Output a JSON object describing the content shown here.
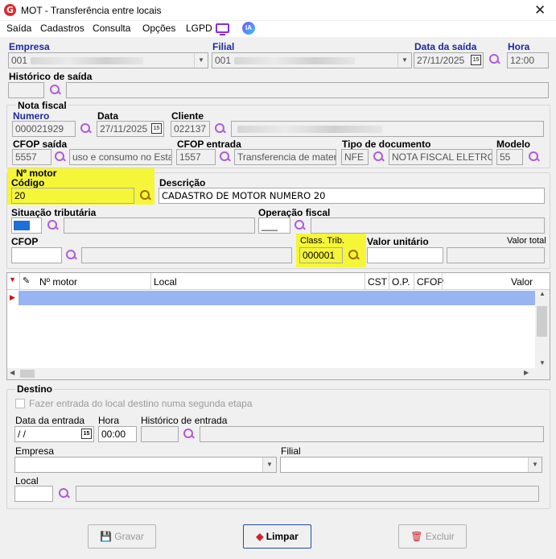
{
  "window": {
    "title": "MOT - Transferência entre locais",
    "app_logo": "G",
    "close": "✕"
  },
  "menu": {
    "items": [
      "Saída",
      "Cadastros",
      "Consulta",
      "Opções",
      "LGPD"
    ],
    "ia": "IA"
  },
  "header": {
    "empresa_label": "Empresa",
    "empresa_value": "001",
    "filial_label": "Filial",
    "filial_value": "001",
    "data_saida_label": "Data da saída",
    "data_saida_value": "27/11/2025",
    "hora_label": "Hora",
    "hora_value": "12:00",
    "historico_label": "Histórico de saída"
  },
  "nota": {
    "group_label": "Nota fiscal",
    "numero_label": "Numero",
    "numero_value": "000021929",
    "data_label": "Data",
    "data_value": "27/11/2025",
    "cliente_label": "Cliente",
    "cliente_value": "022137",
    "cfop_saida_label": "CFOP saída",
    "cfop_saida_value": "5557",
    "cfop_saida_desc": "uso e consumo no Estado",
    "cfop_entrada_label": "CFOP entrada",
    "cfop_entrada_value": "1557",
    "cfop_entrada_desc": "Transferencia de material",
    "tipo_doc_label": "Tipo de documento",
    "tipo_doc_value": "NFE",
    "tipo_doc_desc": "NOTA FISCAL ELETRON",
    "modelo_label": "Modelo",
    "modelo_value": "55"
  },
  "motor": {
    "group_label": "Nº motor",
    "codigo_label": "Código",
    "codigo_value": "20",
    "descricao_label": "Descrição",
    "descricao_value": "CADASTRO DE MOTOR NUMERO 20",
    "sit_trib_label": "Situação tributária",
    "op_fiscal_label": "Operação fiscal",
    "op_fiscal_value": "___",
    "cfop_label": "CFOP",
    "class_trib_label": "Class. Trib.",
    "class_trib_value": "000001",
    "valor_unit_label": "Valor unitário",
    "valor_total_label": "Valor total"
  },
  "grid": {
    "columns": [
      "Nº motor",
      "Local",
      "CST",
      "O.P.",
      "CFOP",
      "Valor"
    ]
  },
  "destino": {
    "group_label": "Destino",
    "checkbox_label": "Fazer entrada do local destino numa segunda etapa",
    "data_entrada_label": "Data da entrada",
    "data_entrada_value": " /  /",
    "hora_label": "Hora",
    "hora_value": "00:00",
    "historico_label": "Histórico de entrada",
    "empresa_label": "Empresa",
    "filial_label": "Filial",
    "local_label": "Local"
  },
  "buttons": {
    "gravar": "Gravar",
    "limpar": "Limpar",
    "excluir": "Excluir"
  },
  "colors": {
    "highlight": "#f6f638",
    "label_blue": "#1c2aa3",
    "search_icon": "#b05bd8",
    "selected_row": "#99b4f2"
  }
}
